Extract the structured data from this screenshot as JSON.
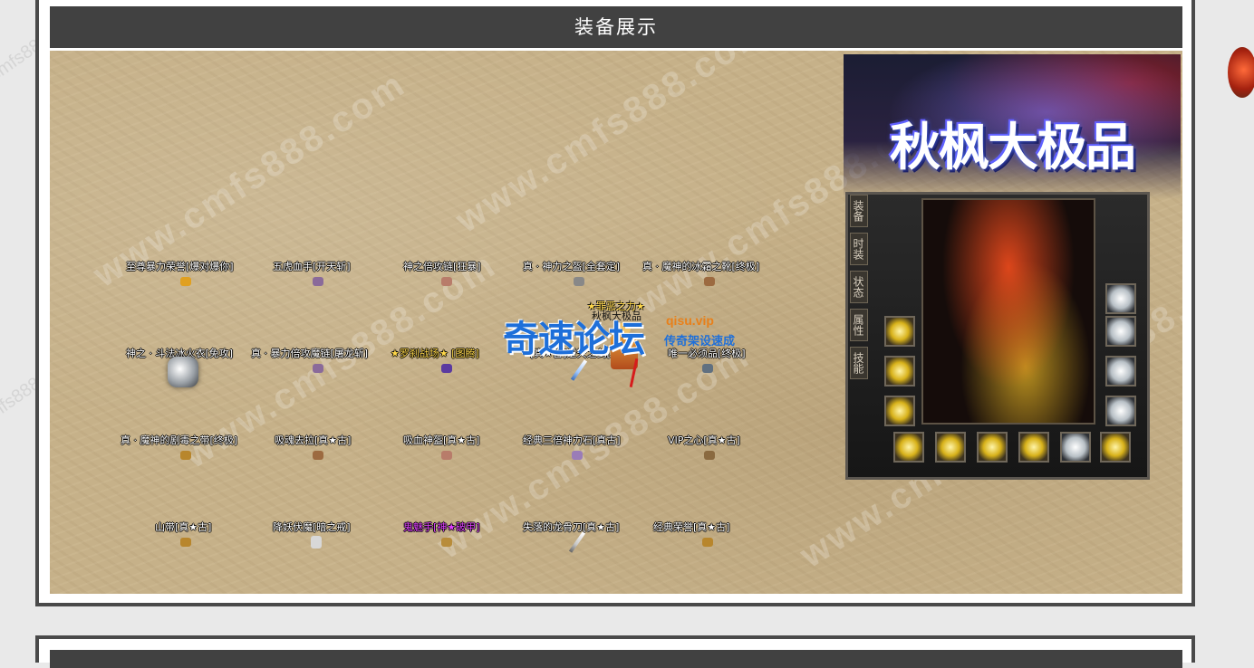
{
  "section": {
    "title": "装备展示"
  },
  "watermarks": {
    "site": "www.cmfs888.com",
    "site_short": "cmfs888.com"
  },
  "items": [
    {
      "label": "至尊暴力荣誉[爆对爆你]",
      "style": "white",
      "icon_color": "#e0a020"
    },
    {
      "label": "五虎血手[开天斩]",
      "style": "white",
      "icon_color": "#8a6a9a"
    },
    {
      "label": "神之倍攻链[狂暴]",
      "style": "white",
      "icon_color": "#b87c6a"
    },
    {
      "label": "真 · 神力之盔[全套定]",
      "style": "white",
      "icon_color": "#888888"
    },
    {
      "label": "真 · 魔神的冰霜之靴[终极]",
      "style": "white",
      "icon_color": "#9c6a40"
    },
    {
      "label": "神之 · 斗法冰火衣[免攻]",
      "style": "white",
      "icon_color": "#cfd5da"
    },
    {
      "label": "真 · 暴力倍攻魔链[屠龙斩]",
      "style": "white",
      "icon_color": "#8a6a9a"
    },
    {
      "label": "★罗刹战场★ [图腾]",
      "style": "gold",
      "icon_color": "#5a3aa0"
    },
    {
      "label": "[真★古]逆天之剑[真]",
      "style": "white",
      "icon_color": "#6ea0e0"
    },
    {
      "label": "唯一必须品[终极]",
      "style": "white",
      "icon_color": "#607080"
    },
    {
      "label": "真 · 魔神的剧毒之带[终极]",
      "style": "white",
      "icon_color": "#b8862c"
    },
    {
      "label": "吸魂去拉[真★古]",
      "style": "white",
      "icon_color": "#9c6a40"
    },
    {
      "label": "吸血神盔[真★古]",
      "style": "white",
      "icon_color": "#b87c6a"
    },
    {
      "label": "经典三倍神力石[真古]",
      "style": "white",
      "icon_color": "#9a7cb8"
    },
    {
      "label": "VIP之心[真★古]",
      "style": "white",
      "icon_color": "#8a6a40"
    },
    {
      "label": "山带[真★古]",
      "style": "white",
      "icon_color": "#b8862c"
    },
    {
      "label": "降妖伏魔[暗之戒]",
      "style": "white",
      "icon_color": "#d8d8d8"
    },
    {
      "label": "鬼魅手[神★破甲]",
      "style": "purple",
      "icon_color": "#b88c3a"
    },
    {
      "label": "失落的龙骨刀[真★古]",
      "style": "white",
      "icon_color": "#c8c8c8"
    },
    {
      "label": "经典荣誉[真★古]",
      "style": "white",
      "icon_color": "#b8862c"
    }
  ],
  "player": {
    "title": "★罪恶之力★",
    "name": "秋枫大极品"
  },
  "logo": {
    "main": "奇速论坛",
    "url": "qisu.vip",
    "sub": "传奇架设速成"
  },
  "equipment_panel": {
    "banner_title": "秋枫大极品",
    "tabs": [
      "装备",
      "时装",
      "状态",
      "属性",
      "技能"
    ]
  },
  "colors": {
    "title_bar": "#414141",
    "page_bg": "#e9e9e9",
    "sand": "#c6b189",
    "logo_blue": "#1e6fd9",
    "logo_orange": "#e8801a"
  }
}
